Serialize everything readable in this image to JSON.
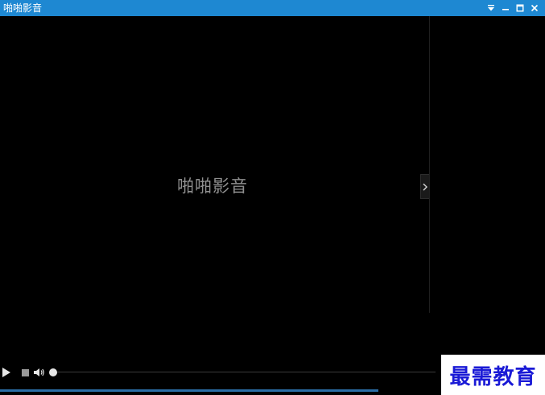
{
  "window": {
    "title": "啪啪影音",
    "titlebar_color": "#1e88d2",
    "controls": [
      "menu-icon",
      "minimize-icon",
      "maximize-icon",
      "close-icon"
    ]
  },
  "player": {
    "logo_text": "啪啪影音",
    "background": "#000000",
    "panel_toggle_icon": "chevron-right-icon"
  },
  "playback": {
    "play_icon": "play-icon",
    "stop_icon": "stop-icon",
    "volume_icon": "volume-icon",
    "progress": 0
  },
  "watermark": {
    "text": "最需教育",
    "color": "#1a1ad6"
  }
}
